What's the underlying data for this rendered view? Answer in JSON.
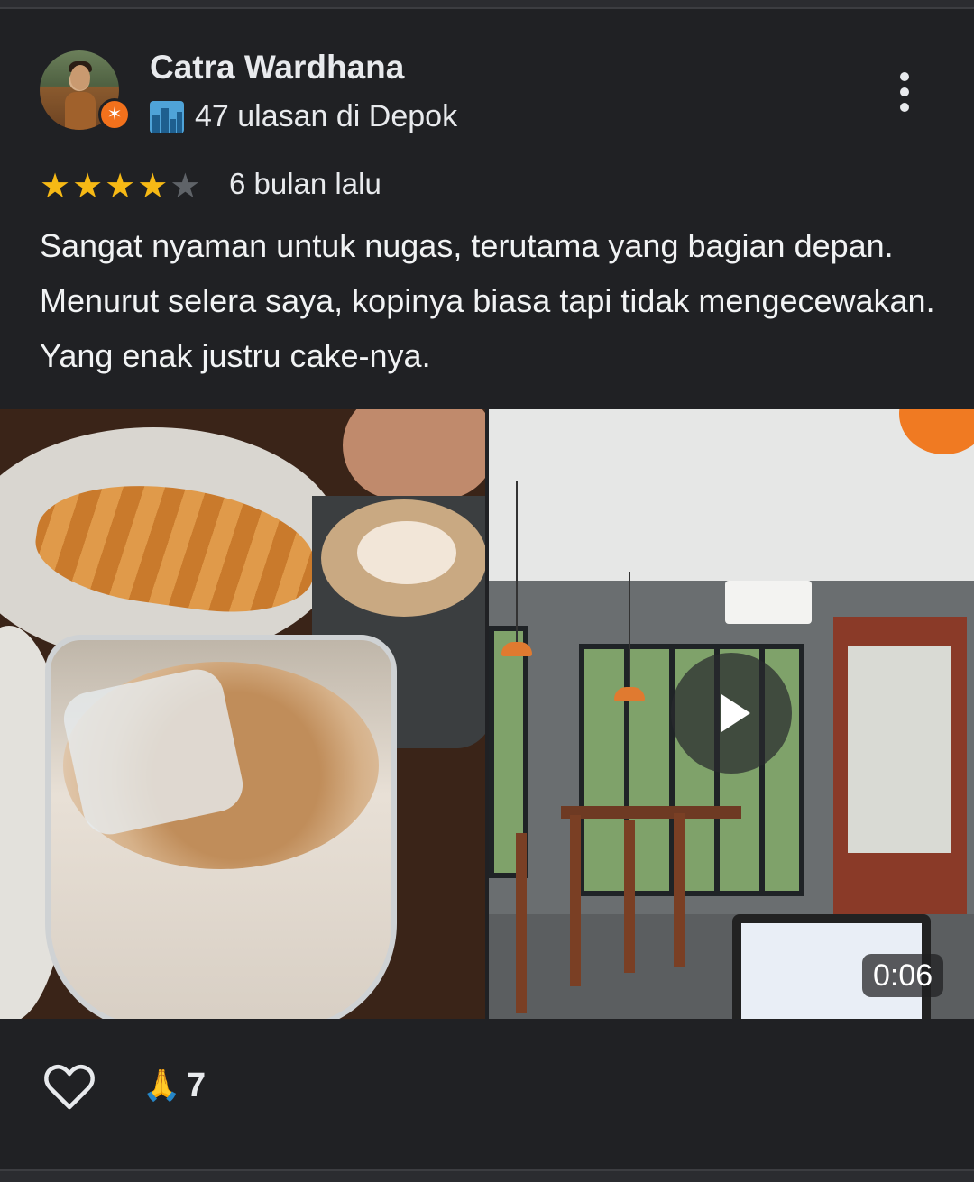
{
  "reviewer": {
    "name": "Catra Wardhana",
    "meta": "47 ulasan di Depok",
    "badge_icon": "local-guide-star-icon",
    "city_icon": "city-skyline-icon"
  },
  "rating": {
    "stars": 4,
    "max": 5,
    "time": "6 bulan lalu",
    "star_color": "#f6b915"
  },
  "review_text": "Sangat nyaman untuk nugas, terutama yang bagian depan. Menurut selera saya, kopinya biasa tapi tidak mengecewakan. Yang enak justru cake-nya.",
  "media": [
    {
      "type": "photo",
      "subject": "croissant, latte and iced coffee"
    },
    {
      "type": "video",
      "subject": "cafe interior",
      "duration": "0:06"
    }
  ],
  "reactions": {
    "like_icon": "heart-outline-icon",
    "emoji": "🙏",
    "count": "7"
  }
}
